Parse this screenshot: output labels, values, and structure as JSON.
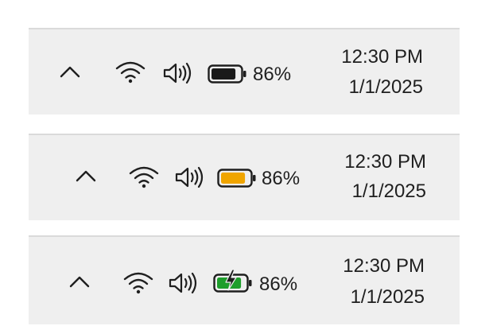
{
  "trays": [
    {
      "battery": {
        "state": "normal",
        "fill_color": "#1a1a1a",
        "level_percent": 86,
        "icon": "battery-icon",
        "percent_label": "86%"
      },
      "time": "12:30 PM",
      "date": "1/1/2025"
    },
    {
      "battery": {
        "state": "battery-saver",
        "fill_color": "#f0a500",
        "level_percent": 86,
        "icon": "battery-saver-icon",
        "percent_label": "86%"
      },
      "time": "12:30 PM",
      "date": "1/1/2025"
    },
    {
      "battery": {
        "state": "charging",
        "fill_color": "#1e9e2c",
        "level_percent": 86,
        "icon": "battery-charging-icon",
        "percent_label": "86%"
      },
      "time": "12:30 PM",
      "date": "1/1/2025"
    }
  ],
  "icons": {
    "overflow": "chevron-up-icon",
    "network": "wifi-icon",
    "sound": "volume-icon"
  }
}
